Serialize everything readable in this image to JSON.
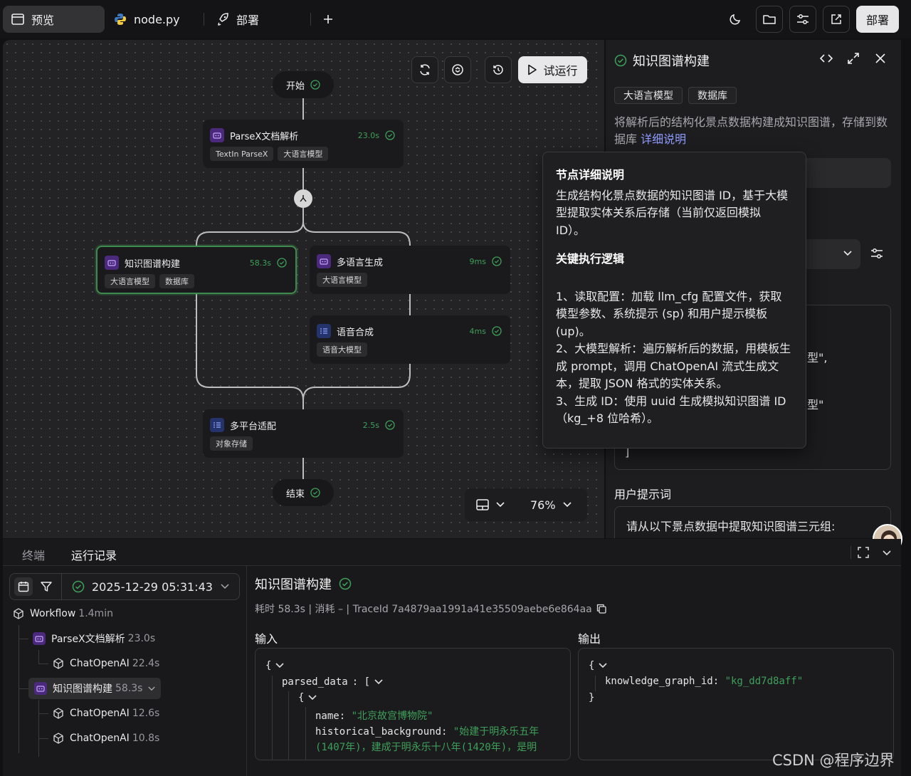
{
  "topbar": {
    "tabs": [
      {
        "label": "预览",
        "icon": "window-icon",
        "active": true
      },
      {
        "label": "node.py",
        "icon": "python-icon",
        "active": false
      },
      {
        "label": "部署",
        "icon": "rocket-icon",
        "active": false
      }
    ],
    "deploy_label": "部署"
  },
  "canvas": {
    "start_label": "开始",
    "end_label": "结束",
    "run_label": "试运行",
    "zoom": "76%",
    "nodes": [
      {
        "title": "ParseX文档解析",
        "time": "23.0s",
        "tags": [
          "TextIn ParseX",
          "大语言模型"
        ],
        "color": "purple"
      },
      {
        "title": "知识图谱构建",
        "time": "58.3s",
        "tags": [
          "大语言模型",
          "数据库"
        ],
        "color": "purple",
        "selected": true
      },
      {
        "title": "多语言生成",
        "time": "9ms",
        "tags": [
          "大语言模型"
        ],
        "color": "purple"
      },
      {
        "title": "语音合成",
        "time": "4ms",
        "tags": [
          "语音大模型"
        ],
        "color": "blue"
      },
      {
        "title": "多平台适配",
        "time": "2.5s",
        "tags": [
          "对象存储"
        ],
        "color": "blue"
      }
    ]
  },
  "panel": {
    "title": "知识图谱构建",
    "tags": [
      "大语言模型",
      "数据库"
    ],
    "description": "将解析后的结构化景点数据构建成知识图谱，存储到数据库",
    "detail_link": "详细说明",
    "code_fragments": [
      "型\",",
      "型\"",
      "]"
    ],
    "user_prompt_label": "用户提示词",
    "user_prompt_text": "请从以下景点数据中提取知识图谱三元组:"
  },
  "tooltip": {
    "title1": "节点详细说明",
    "body1": "生成结构化景点数据的知识图谱 ID，基于大模型提取实体关系后存储（当前仅返回模拟 ID）。",
    "title2": "关键执行逻辑",
    "step1": "1、读取配置：加载 llm_cfg 配置文件，获取模型参数、系统提示 (sp) 和用户提示模板 (up)。",
    "step2": "2、大模型解析：遍历解析后的数据，用模板生成 prompt，调用 ChatOpenAI 流式生成文本，提取 JSON 格式的实体关系。",
    "step3": "3、生成 ID：使用 uuid 生成模拟知识图谱 ID（kg_+8 位哈希）。"
  },
  "bottom": {
    "tabs": [
      "终端",
      "运行记录"
    ],
    "run_time": "2025-12-29 05:31:43",
    "tree": [
      {
        "label": "Workflow",
        "dur": "1.4min",
        "level": 0,
        "icon": "cube-icon"
      },
      {
        "label": "ParseX文档解析",
        "dur": "23.0s",
        "level": 1,
        "icon": "bot-icon"
      },
      {
        "label": "ChatOpenAI",
        "dur": "22.4s",
        "level": 2,
        "icon": "cube-icon"
      },
      {
        "label": "知识图谱构建",
        "dur": "58.3s",
        "level": 1,
        "icon": "bot-icon",
        "selected": true
      },
      {
        "label": "ChatOpenAI",
        "dur": "12.6s",
        "level": 2,
        "icon": "cube-icon"
      },
      {
        "label": "ChatOpenAI",
        "dur": "10.8s",
        "level": 2,
        "icon": "cube-icon"
      }
    ],
    "detail": {
      "title": "知识图谱构建",
      "meta": "耗时 58.3s | 消耗 – | TraceId 7a4879aa1991a41e35509aebe6e864aa",
      "input_label": "输入",
      "output_label": "输出",
      "input_key": "parsed_data",
      "name_key": "name",
      "name_value": "\"北京故宫博物院\"",
      "bg_key": "historical_background",
      "bg_value_line1": "\"始建于明永乐五年",
      "bg_value_line2": "(1407年)，建成于明永乐十八年(1420年)，是明",
      "output_key": "knowledge_graph_id",
      "output_value": "\"kg_dd7d8aff\""
    }
  },
  "watermark": "CSDN @程序边界"
}
